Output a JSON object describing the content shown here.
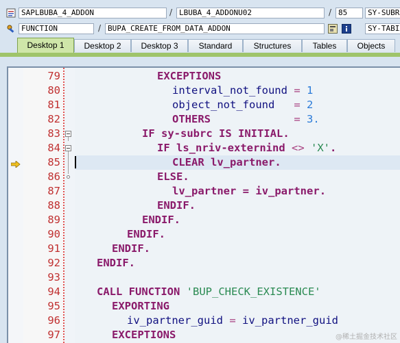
{
  "header": {
    "program": "SAPLBUBA_4_ADDON",
    "include": "LBUBA_4_ADDONU02",
    "line_no": "85",
    "sysfield1": "SY-SUBRC",
    "type": "FUNCTION",
    "object": "BUPA_CREATE_FROM_DATA_ADDON",
    "sysfield2": "SY-TABIX",
    "separator": "/"
  },
  "tabs": [
    "Desktop 1",
    "Desktop 2",
    "Desktop 3",
    "Standard",
    "Structures",
    "Tables",
    "Objects"
  ],
  "editor": {
    "line_numbers": [
      "79",
      "80",
      "81",
      "82",
      "83",
      "84",
      "85",
      "86",
      "87",
      "88",
      "89",
      "90",
      "91",
      "92",
      "93",
      "94",
      "95",
      "96",
      "97"
    ],
    "current_line": "85"
  },
  "code": {
    "l79": [
      "EXCEPTIONS"
    ],
    "l80": [
      "interval_not_found",
      "=",
      "1"
    ],
    "l81": [
      "object_not_found",
      "=",
      "2"
    ],
    "l82": [
      "OTHERS",
      "=",
      "3",
      "."
    ],
    "l83": [
      "IF",
      "sy-subrc",
      "IS INITIAL",
      "."
    ],
    "l84": [
      "IF",
      "ls_nriv-externind",
      "<>",
      "'X'",
      "."
    ],
    "l85": [
      "CLEAR",
      "lv_partner",
      "."
    ],
    "l86": [
      "ELSE."
    ],
    "l87": [
      "lv_partner",
      "=",
      "iv_partner",
      "."
    ],
    "l88": [
      "ENDIF."
    ],
    "l89": [
      "ENDIF."
    ],
    "l90": [
      "ENDIF."
    ],
    "l91": [
      "ENDIF."
    ],
    "l92": [
      "ENDIF."
    ],
    "l94": [
      "CALL FUNCTION",
      "'BUP_CHECK_EXISTENCE'"
    ],
    "l95": [
      "EXPORTING"
    ],
    "l96": [
      "iv_partner_guid",
      "=",
      "iv_partner_guid"
    ],
    "l97": [
      "EXCEPTIONS"
    ]
  },
  "watermark": "@稀土掘金技术社区"
}
